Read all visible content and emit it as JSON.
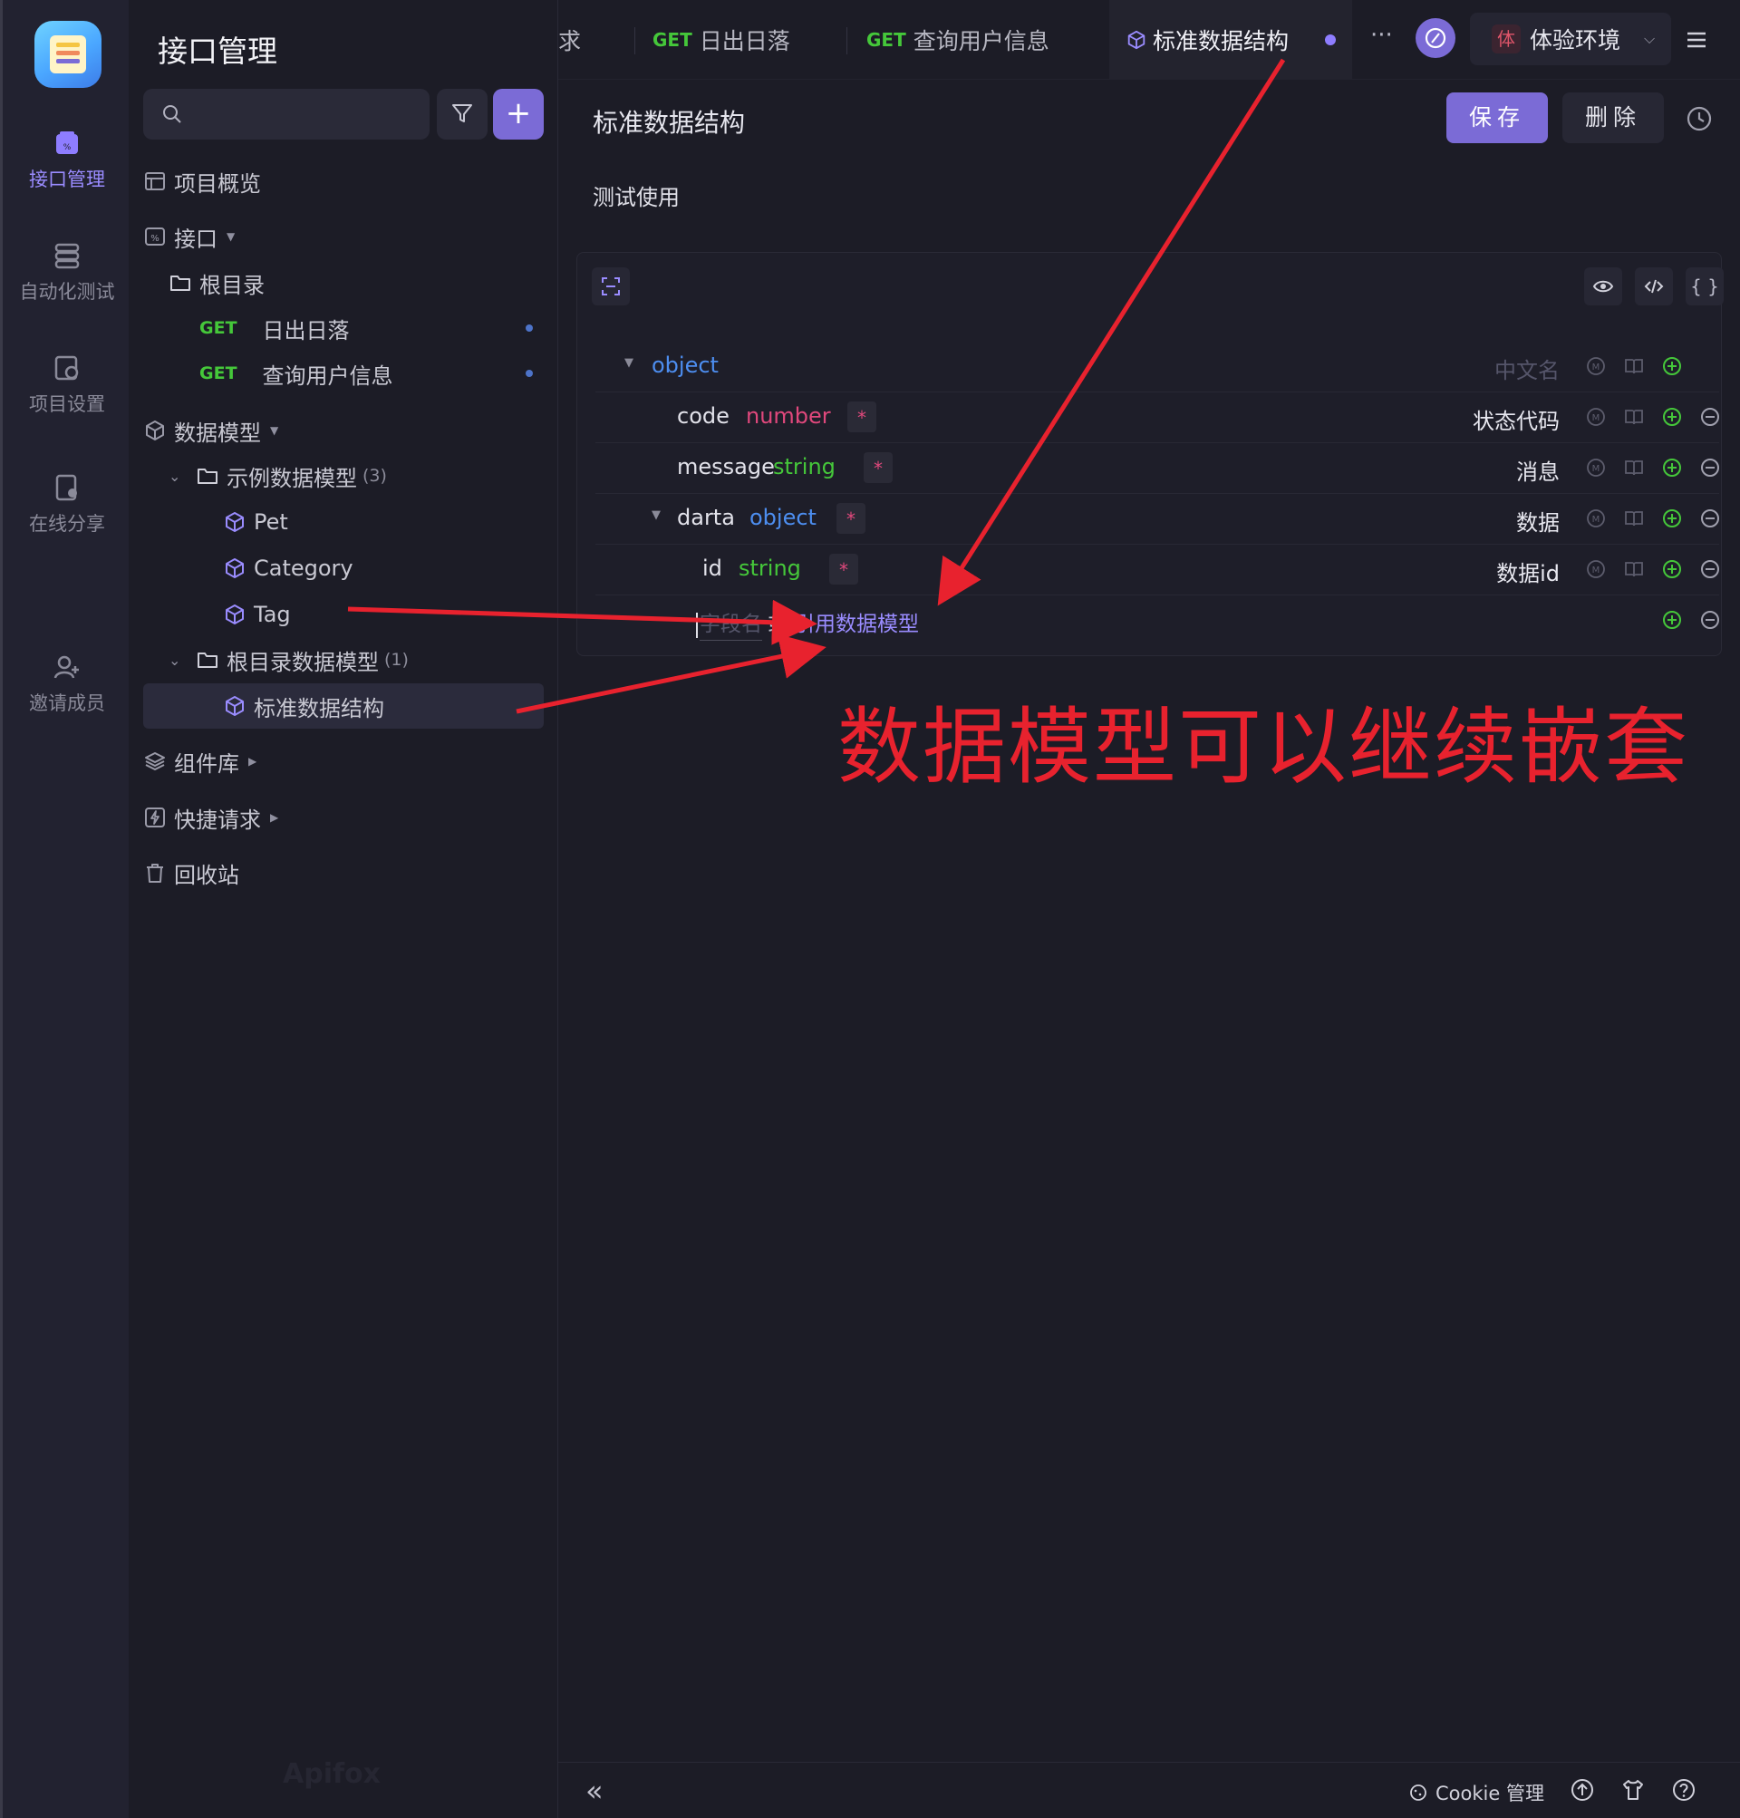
{
  "rail": {
    "items": [
      {
        "label": "接口管理"
      },
      {
        "label": "自动化测试"
      },
      {
        "label": "项目设置"
      },
      {
        "label": "在线分享"
      },
      {
        "label": "邀请成员"
      }
    ]
  },
  "sidebar": {
    "title": "接口管理",
    "search_placeholder": "",
    "overview": "项目概览",
    "api_section": "接口",
    "root_folder": "根目录",
    "apis": [
      {
        "method": "GET",
        "name": "日出日落"
      },
      {
        "method": "GET",
        "name": "查询用户信息"
      }
    ],
    "model_section": "数据模型",
    "example_folder": "示例数据模型",
    "example_count": "(3)",
    "example_models": [
      "Pet",
      "Category",
      "Tag"
    ],
    "root_model_folder": "根目录数据模型",
    "root_model_count": "(1)",
    "root_models": [
      "标准数据结构"
    ],
    "components": "组件库",
    "quick_request": "快捷请求",
    "recycle": "回收站",
    "watermark": "Apifox"
  },
  "tabs": {
    "partial": "求",
    "items": [
      {
        "method": "GET",
        "name": "日出日落"
      },
      {
        "method": "GET",
        "name": "查询用户信息"
      }
    ],
    "active": "标准数据结构",
    "more": "···",
    "env_badge": "体",
    "env_name": "体验环境"
  },
  "main": {
    "title": "标准数据结构",
    "save": "保存",
    "delete": "删除",
    "description": "测试使用",
    "schema": {
      "root_type": "object",
      "root_cname_placeholder": "中文名",
      "fields": [
        {
          "name": "code",
          "type": "number",
          "required": "*",
          "cname": "状态代码"
        },
        {
          "name": "message",
          "type": "string",
          "required": "*",
          "cname": "消息"
        },
        {
          "name": "darta",
          "type": "object",
          "required": "*",
          "cname": "数据"
        },
        {
          "name": "id",
          "type": "string",
          "required": "*",
          "cname": "数据id"
        }
      ],
      "new_field_placeholder": "字段名",
      "new_field_or": "或",
      "new_field_ref": "引用数据模型",
      "tool_icons": [
        "eye-icon",
        "code-icon",
        "braces-icon"
      ]
    }
  },
  "bottom": {
    "collapse": "«",
    "cookie": "Cookie 管理"
  },
  "annotation": {
    "text": "数据模型可以继续嵌套",
    "color": "#e8222e"
  },
  "colors": {
    "accent": "#7b6bd6",
    "get": "#45c73a",
    "object_type": "#4d8ef0",
    "number_type": "#e0487c",
    "string_type": "#45c73a"
  }
}
